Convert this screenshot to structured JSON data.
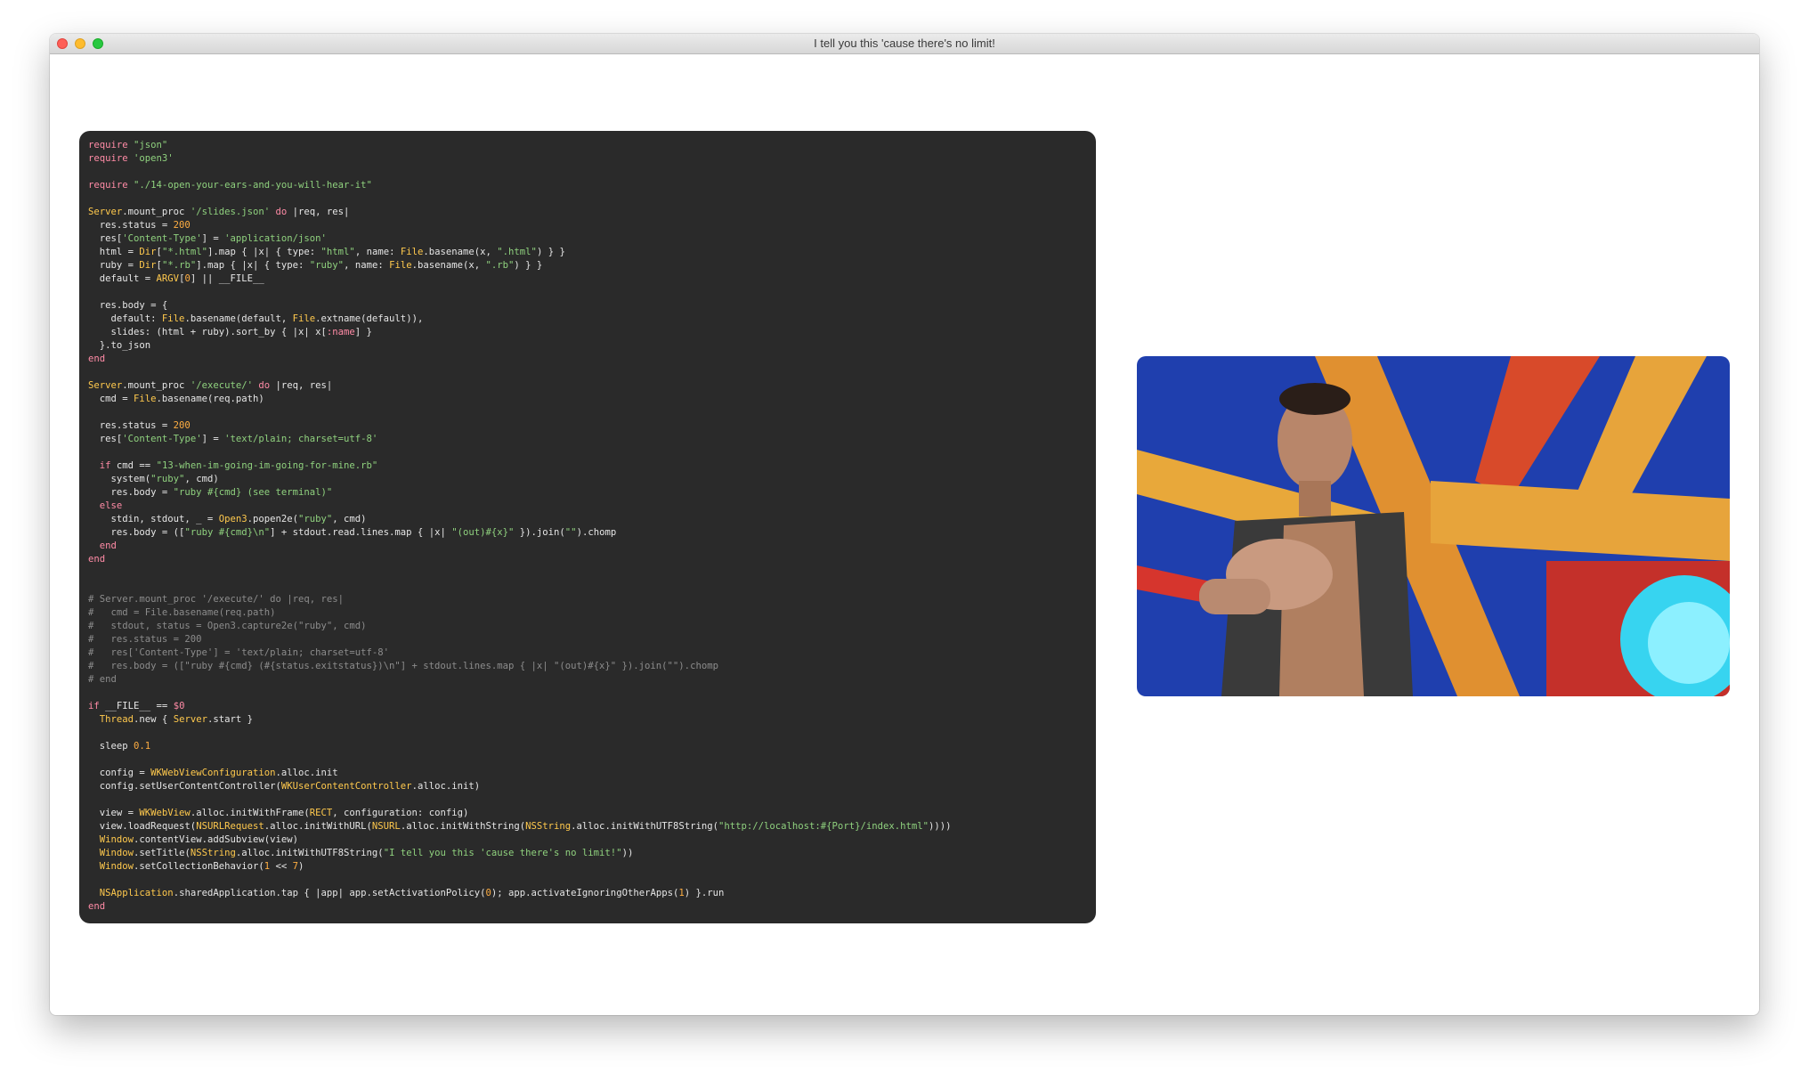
{
  "window": {
    "title": "I tell you this 'cause there's no limit!"
  },
  "code_lines": [
    [
      [
        "k",
        "require"
      ],
      [
        "t",
        " "
      ],
      [
        "s",
        "\"json\""
      ]
    ],
    [
      [
        "k",
        "require"
      ],
      [
        "t",
        " "
      ],
      [
        "s",
        "'open3'"
      ]
    ],
    [],
    [
      [
        "k",
        "require"
      ],
      [
        "t",
        " "
      ],
      [
        "s",
        "\"./14-open-your-ears-and-you-will-hear-it\""
      ]
    ],
    [],
    [
      [
        "cl",
        "Server"
      ],
      [
        "t",
        ".mount_proc "
      ],
      [
        "s",
        "'/slides.json'"
      ],
      [
        "t",
        " "
      ],
      [
        "k",
        "do"
      ],
      [
        "t",
        " |req, res|"
      ]
    ],
    [
      [
        "t",
        "  res.status = "
      ],
      [
        "n",
        "200"
      ]
    ],
    [
      [
        "t",
        "  res["
      ],
      [
        "s",
        "'Content-Type'"
      ],
      [
        "t",
        "] = "
      ],
      [
        "s",
        "'application/json'"
      ]
    ],
    [
      [
        "t",
        "  html = "
      ],
      [
        "cl",
        "Dir"
      ],
      [
        "t",
        "["
      ],
      [
        "s",
        "\"*.html\""
      ],
      [
        "t",
        "].map { |x| { type: "
      ],
      [
        "s",
        "\"html\""
      ],
      [
        "t",
        ", name: "
      ],
      [
        "cl",
        "File"
      ],
      [
        "t",
        ".basename(x, "
      ],
      [
        "s",
        "\".html\""
      ],
      [
        "t",
        ") } }"
      ]
    ],
    [
      [
        "t",
        "  ruby = "
      ],
      [
        "cl",
        "Dir"
      ],
      [
        "t",
        "["
      ],
      [
        "s",
        "\"*.rb\""
      ],
      [
        "t",
        "].map { |x| { type: "
      ],
      [
        "s",
        "\"ruby\""
      ],
      [
        "t",
        ", name: "
      ],
      [
        "cl",
        "File"
      ],
      [
        "t",
        ".basename(x, "
      ],
      [
        "s",
        "\".rb\""
      ],
      [
        "t",
        ") } }"
      ]
    ],
    [
      [
        "t",
        "  default = "
      ],
      [
        "cl",
        "ARGV"
      ],
      [
        "t",
        "["
      ],
      [
        "n",
        "0"
      ],
      [
        "t",
        "] || __FILE__"
      ]
    ],
    [],
    [
      [
        "t",
        "  res.body = {"
      ]
    ],
    [
      [
        "t",
        "    default: "
      ],
      [
        "cl",
        "File"
      ],
      [
        "t",
        ".basename(default, "
      ],
      [
        "cl",
        "File"
      ],
      [
        "t",
        ".extname(default)),"
      ]
    ],
    [
      [
        "t",
        "    slides: (html + ruby).sort_by { |x| x["
      ],
      [
        "k",
        ":name"
      ],
      [
        "t",
        "] }"
      ]
    ],
    [
      [
        "t",
        "  }.to_json"
      ]
    ],
    [
      [
        "k",
        "end"
      ]
    ],
    [],
    [
      [
        "cl",
        "Server"
      ],
      [
        "t",
        ".mount_proc "
      ],
      [
        "s",
        "'/execute/'"
      ],
      [
        "t",
        " "
      ],
      [
        "k",
        "do"
      ],
      [
        "t",
        " |req, res|"
      ]
    ],
    [
      [
        "t",
        "  cmd = "
      ],
      [
        "cl",
        "File"
      ],
      [
        "t",
        ".basename(req.path)"
      ]
    ],
    [],
    [
      [
        "t",
        "  res.status = "
      ],
      [
        "n",
        "200"
      ]
    ],
    [
      [
        "t",
        "  res["
      ],
      [
        "s",
        "'Content-Type'"
      ],
      [
        "t",
        "] = "
      ],
      [
        "s",
        "'text/plain; charset=utf-8'"
      ]
    ],
    [],
    [
      [
        "t",
        "  "
      ],
      [
        "k",
        "if"
      ],
      [
        "t",
        " cmd == "
      ],
      [
        "s",
        "\"13-when-im-going-im-going-for-mine.rb\""
      ]
    ],
    [
      [
        "t",
        "    system("
      ],
      [
        "s",
        "\"ruby\""
      ],
      [
        "t",
        ", cmd)"
      ]
    ],
    [
      [
        "t",
        "    res.body = "
      ],
      [
        "s",
        "\"ruby #{cmd} (see terminal)\""
      ]
    ],
    [
      [
        "t",
        "  "
      ],
      [
        "k",
        "else"
      ]
    ],
    [
      [
        "t",
        "    stdin, stdout, _ = "
      ],
      [
        "cl",
        "Open3"
      ],
      [
        "t",
        ".popen2e("
      ],
      [
        "s",
        "\"ruby\""
      ],
      [
        "t",
        ", cmd)"
      ]
    ],
    [
      [
        "t",
        "    res.body = (["
      ],
      [
        "s",
        "\"ruby #{cmd}\\n\""
      ],
      [
        "t",
        "] + stdout.read.lines.map { |x| "
      ],
      [
        "s",
        "\"(out)#{x}\""
      ],
      [
        "t",
        " }).join("
      ],
      [
        "s",
        "\"\""
      ],
      [
        "t",
        ").chomp"
      ]
    ],
    [
      [
        "t",
        "  "
      ],
      [
        "k",
        "end"
      ]
    ],
    [
      [
        "k",
        "end"
      ]
    ],
    [],
    [],
    [
      [
        "c",
        "# Server.mount_proc '/execute/' do |req, res|"
      ]
    ],
    [
      [
        "c",
        "#   cmd = File.basename(req.path)"
      ]
    ],
    [
      [
        "c",
        "#   stdout, status = Open3.capture2e(\"ruby\", cmd)"
      ]
    ],
    [
      [
        "c",
        "#   res.status = 200"
      ]
    ],
    [
      [
        "c",
        "#   res['Content-Type'] = 'text/plain; charset=utf-8'"
      ]
    ],
    [
      [
        "c",
        "#   res.body = ([\"ruby #{cmd} (#{status.exitstatus})\\n\"] + stdout.lines.map { |x| \"(out)#{x}\" }).join(\"\").chomp"
      ]
    ],
    [
      [
        "c",
        "# end"
      ]
    ],
    [],
    [
      [
        "k",
        "if"
      ],
      [
        "t",
        " __FILE__ == "
      ],
      [
        "k",
        "$0"
      ]
    ],
    [
      [
        "t",
        "  "
      ],
      [
        "cl",
        "Thread"
      ],
      [
        "t",
        ".new { "
      ],
      [
        "cl",
        "Server"
      ],
      [
        "t",
        ".start }"
      ]
    ],
    [],
    [
      [
        "t",
        "  sleep "
      ],
      [
        "n",
        "0.1"
      ]
    ],
    [],
    [
      [
        "t",
        "  config = "
      ],
      [
        "cl",
        "WKWebViewConfiguration"
      ],
      [
        "t",
        ".alloc.init"
      ]
    ],
    [
      [
        "t",
        "  config.setUserContentController("
      ],
      [
        "cl",
        "WKUserContentController"
      ],
      [
        "t",
        ".alloc.init)"
      ]
    ],
    [],
    [
      [
        "t",
        "  view = "
      ],
      [
        "cl",
        "WKWebView"
      ],
      [
        "t",
        ".alloc.initWithFrame("
      ],
      [
        "cl",
        "RECT"
      ],
      [
        "t",
        ", configuration: config)"
      ]
    ],
    [
      [
        "t",
        "  view.loadRequest("
      ],
      [
        "cl",
        "NSURLRequest"
      ],
      [
        "t",
        ".alloc.initWithURL("
      ],
      [
        "cl",
        "NSURL"
      ],
      [
        "t",
        ".alloc.initWithString("
      ],
      [
        "cl",
        "NSString"
      ],
      [
        "t",
        ".alloc.initWithUTF8String("
      ],
      [
        "s",
        "\"http://localhost:#{Port}/index.html\""
      ],
      [
        "t",
        "))))"
      ]
    ],
    [
      [
        "t",
        "  "
      ],
      [
        "cl",
        "Window"
      ],
      [
        "t",
        ".contentView.addSubview(view)"
      ]
    ],
    [
      [
        "t",
        "  "
      ],
      [
        "cl",
        "Window"
      ],
      [
        "t",
        ".setTitle("
      ],
      [
        "cl",
        "NSString"
      ],
      [
        "t",
        ".alloc.initWithUTF8String("
      ],
      [
        "s",
        "\"I tell you this 'cause there's no limit!\""
      ],
      [
        "t",
        "))"
      ]
    ],
    [
      [
        "t",
        "  "
      ],
      [
        "cl",
        "Window"
      ],
      [
        "t",
        ".setCollectionBehavior("
      ],
      [
        "n",
        "1"
      ],
      [
        "t",
        " << "
      ],
      [
        "n",
        "7"
      ],
      [
        "t",
        ")"
      ]
    ],
    [],
    [
      [
        "t",
        "  "
      ],
      [
        "cl",
        "NSApplication"
      ],
      [
        "t",
        ".sharedApplication.tap { |app| app.setActivationPolicy("
      ],
      [
        "n",
        "0"
      ],
      [
        "t",
        "); app.activateIgnoringOtherApps("
      ],
      [
        "n",
        "1"
      ],
      [
        "t",
        ") }.run"
      ]
    ],
    [
      [
        "k",
        "end"
      ]
    ]
  ]
}
